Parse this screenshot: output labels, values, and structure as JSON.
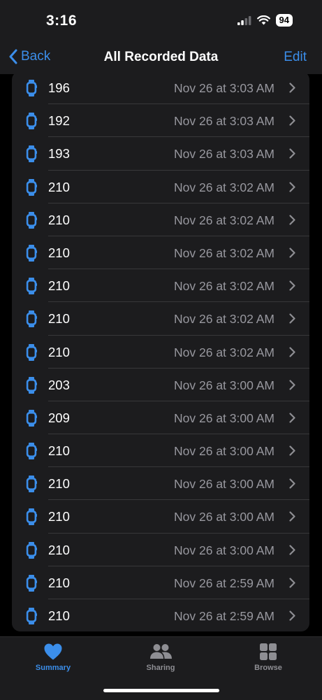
{
  "status_bar": {
    "time": "3:16",
    "battery": "94"
  },
  "nav": {
    "back_label": "Back",
    "title": "All Recorded Data",
    "edit_label": "Edit"
  },
  "rows": [
    {
      "value": "196",
      "date": "Nov 26 at 3:03 AM"
    },
    {
      "value": "192",
      "date": "Nov 26 at 3:03 AM"
    },
    {
      "value": "193",
      "date": "Nov 26 at 3:03 AM"
    },
    {
      "value": "210",
      "date": "Nov 26 at 3:02 AM"
    },
    {
      "value": "210",
      "date": "Nov 26 at 3:02 AM"
    },
    {
      "value": "210",
      "date": "Nov 26 at 3:02 AM"
    },
    {
      "value": "210",
      "date": "Nov 26 at 3:02 AM"
    },
    {
      "value": "210",
      "date": "Nov 26 at 3:02 AM"
    },
    {
      "value": "210",
      "date": "Nov 26 at 3:02 AM"
    },
    {
      "value": "203",
      "date": "Nov 26 at 3:00 AM"
    },
    {
      "value": "209",
      "date": "Nov 26 at 3:00 AM"
    },
    {
      "value": "210",
      "date": "Nov 26 at 3:00 AM"
    },
    {
      "value": "210",
      "date": "Nov 26 at 3:00 AM"
    },
    {
      "value": "210",
      "date": "Nov 26 at 3:00 AM"
    },
    {
      "value": "210",
      "date": "Nov 26 at 3:00 AM"
    },
    {
      "value": "210",
      "date": "Nov 26 at 2:59 AM"
    },
    {
      "value": "210",
      "date": "Nov 26 at 2:59 AM"
    }
  ],
  "tab_bar": {
    "tabs": [
      {
        "label": "Summary",
        "icon": "heart-icon",
        "active": true
      },
      {
        "label": "Sharing",
        "icon": "people-icon",
        "active": false
      },
      {
        "label": "Browse",
        "icon": "grid-icon",
        "active": false
      }
    ]
  },
  "colors": {
    "accent": "#3b8eea",
    "background": "#000000",
    "card": "#1c1c1e",
    "secondary_text": "#98989f"
  }
}
